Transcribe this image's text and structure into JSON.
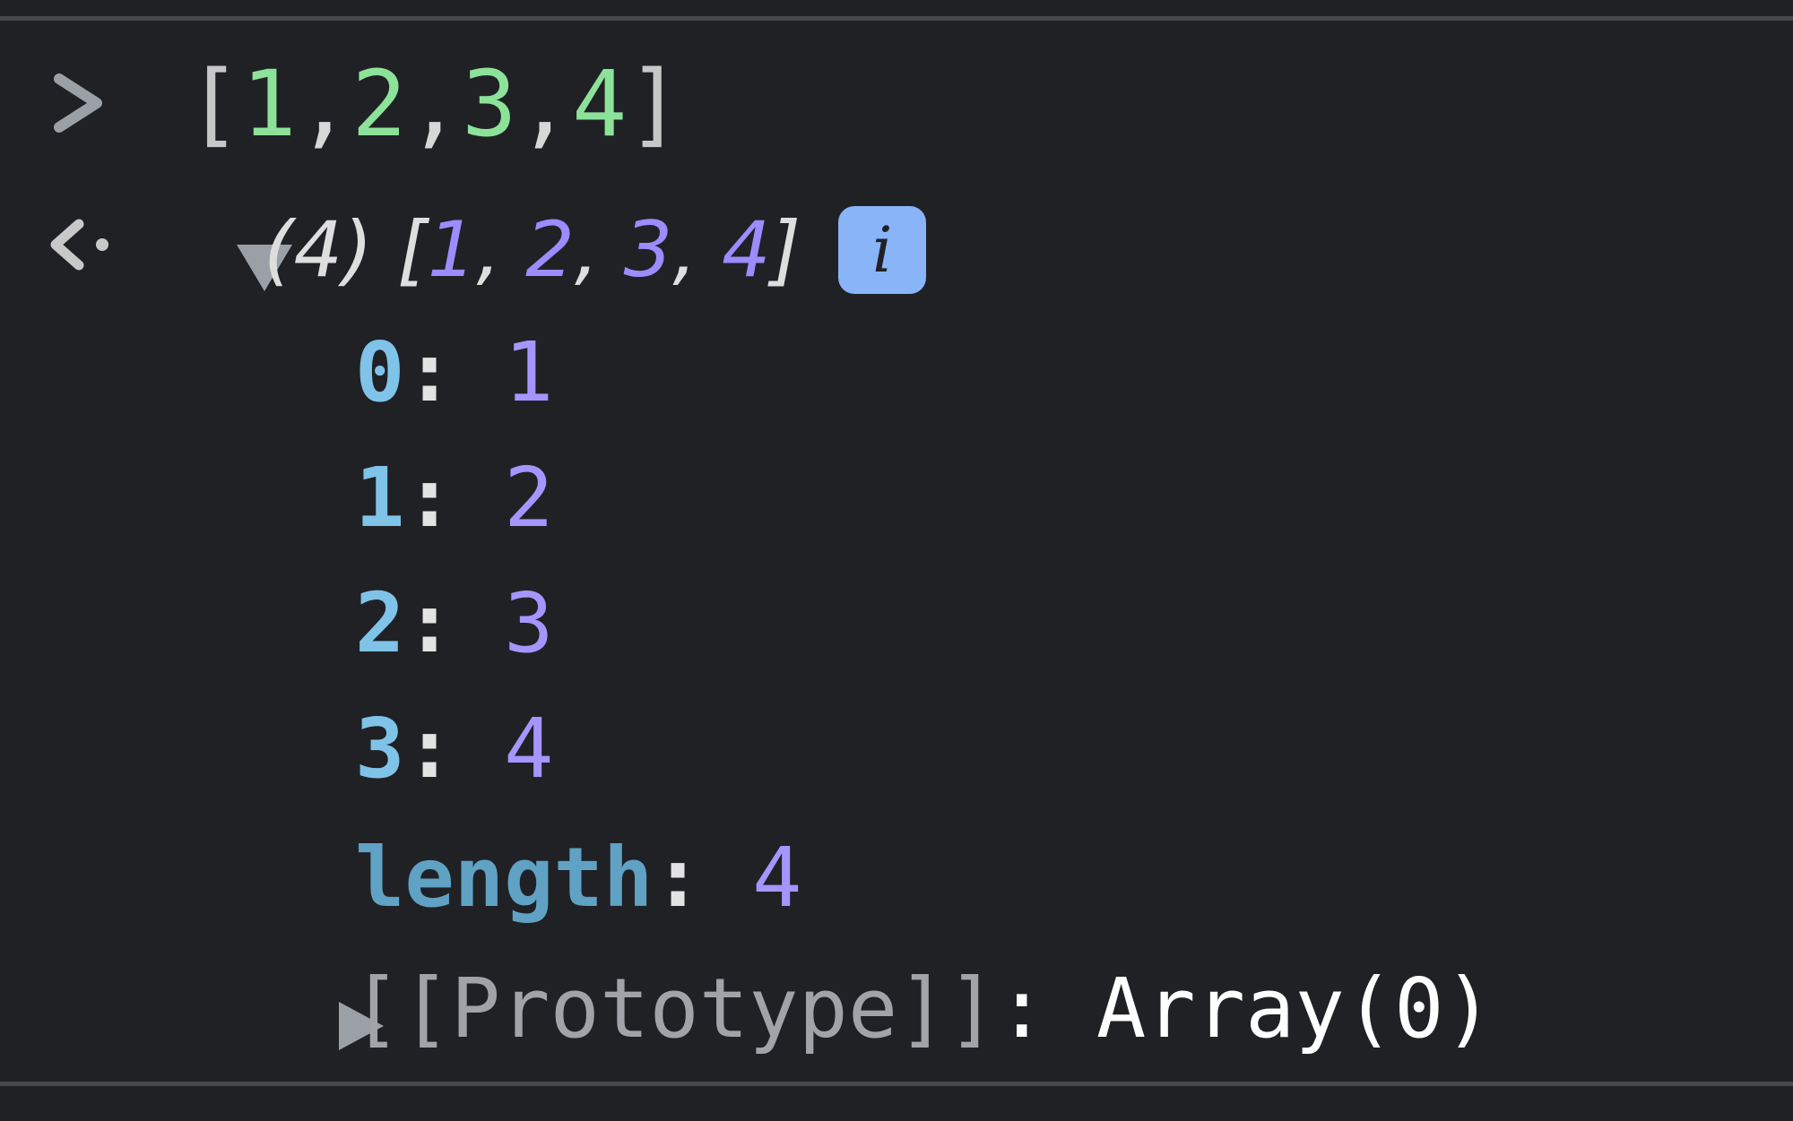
{
  "colors": {
    "background": "#202125",
    "divider": "#47484c",
    "input_number": "#8de29a",
    "result_value": "#9b8cff",
    "property_key": "#7fc3e8",
    "info_badge": "#8ab4f8"
  },
  "input": {
    "prompt_icon": "chevron-right-icon",
    "open_bracket": "[",
    "values": [
      "1",
      "2",
      "3",
      "4"
    ],
    "separator": ",",
    "close_bracket": "]"
  },
  "result": {
    "result_icon": "return-arrow-icon",
    "disclosure_icon": "triangle-down-icon",
    "count": "(4)",
    "open_bracket": "[",
    "values": [
      "1",
      "2",
      "3",
      "4"
    ],
    "separator": ", ",
    "close_bracket": "]",
    "info_label": "i"
  },
  "properties": [
    {
      "key": "0",
      "value": "1"
    },
    {
      "key": "1",
      "value": "2"
    },
    {
      "key": "2",
      "value": "3"
    },
    {
      "key": "3",
      "value": "4"
    },
    {
      "key": "length",
      "value": "4"
    }
  ],
  "prototype": {
    "disclosure_icon": "triangle-right-icon",
    "label": "[[Prototype]]",
    "colon": ": ",
    "value": "Array(0)"
  }
}
